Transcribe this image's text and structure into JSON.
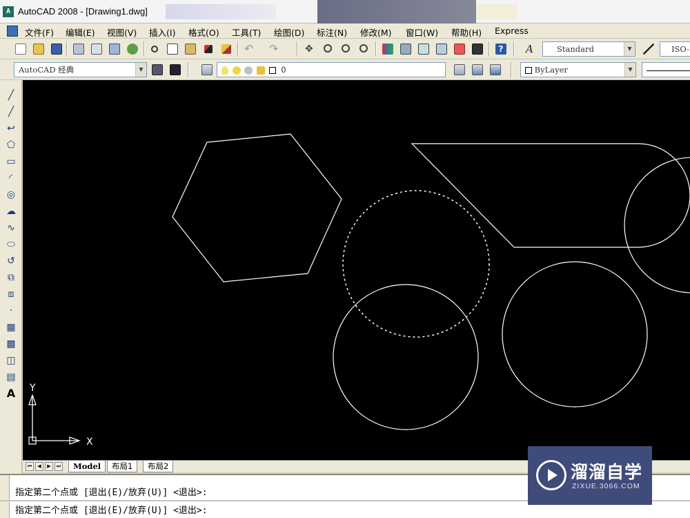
{
  "window": {
    "title": "AutoCAD 2008 - [Drawing1.dwg]",
    "app_icon": "autocad-icon"
  },
  "menubar": {
    "items": [
      "文件(F)",
      "编辑(E)",
      "视图(V)",
      "插入(I)",
      "格式(O)",
      "工具(T)",
      "绘图(D)",
      "标注(N)",
      "修改(M)",
      "窗口(W)",
      "帮助(H)",
      "Express"
    ]
  },
  "toolbar_standard": {
    "text_style": "Standard",
    "dim_style": "ISO-"
  },
  "toolbar_layers": {
    "workspace": "AutoCAD 经典",
    "layer_name": "0",
    "color": "ByLayer"
  },
  "layout_tabs": {
    "tabs": [
      "Model",
      "布局1",
      "布局2"
    ],
    "active": "Model"
  },
  "ucs": {
    "x_label": "X",
    "y_label": "Y"
  },
  "command": {
    "lines": [
      "指定第二个点或 [退出(E)/放弃(U)] <退出>:",
      "指定第二个点或 [退出(E)/放弃(U)] <退出>:"
    ]
  },
  "watermark": {
    "brand": "溜溜自学",
    "url": "ZIXUE.3066.COM"
  },
  "colors": {
    "canvas_bg": "#000000",
    "geometry_stroke": "#ffffff",
    "watermark_bg": "#3f4b7a"
  }
}
